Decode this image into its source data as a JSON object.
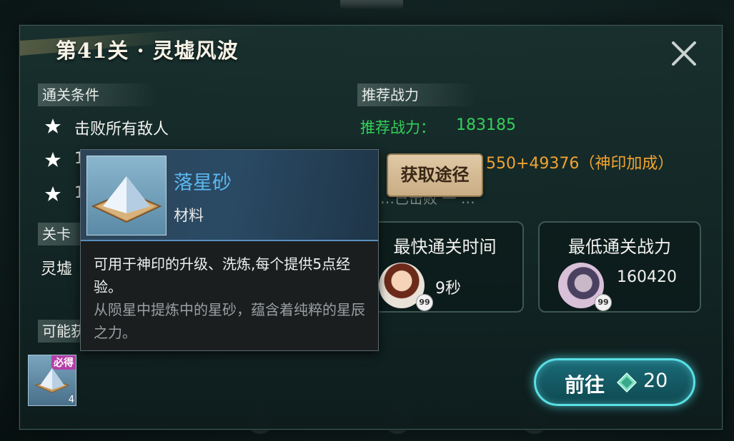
{
  "stage": {
    "title": "第41关 · 灵墟风波"
  },
  "conditions": {
    "header": "通关条件",
    "items": [
      {
        "text": "击败所有敌人"
      },
      {
        "text": "1"
      },
      {
        "text": "1"
      }
    ]
  },
  "power": {
    "header": "推荐战力",
    "rec_label": "推荐战力：",
    "rec_value": "183185",
    "my_power_partial": "550+49376（神印加成）",
    "faded_partial": "…已击败 一 …"
  },
  "stage_info": {
    "header_partial": "关卡",
    "text_partial": "灵墟"
  },
  "rewards": {
    "header_partial": "可能获",
    "item_badge": "必得",
    "item_count": "4"
  },
  "records": {
    "fastest": {
      "title": "最快通关时间",
      "value": "9秒",
      "level": "99"
    },
    "lowest": {
      "title": "最低通关战力",
      "value": "160420",
      "level": "99"
    }
  },
  "buttons": {
    "get_source": "获取途径",
    "go_label": "前往",
    "go_cost": "20"
  },
  "tooltip": {
    "name": "落星砂",
    "type": "材料",
    "desc": "可用于神印的升级、洗炼,每个提供5点经验。",
    "flavor": "从陨星中提炼中的星砂，蕴含着纯粹的星辰之力。"
  },
  "colors": {
    "green": "#34d05a",
    "orange": "#f0a332",
    "cyan": "#59e0e6",
    "item_name": "#5bb8f0"
  },
  "icons": [
    "close-icon",
    "star-icon",
    "gem-icon",
    "star-sand-icon"
  ]
}
